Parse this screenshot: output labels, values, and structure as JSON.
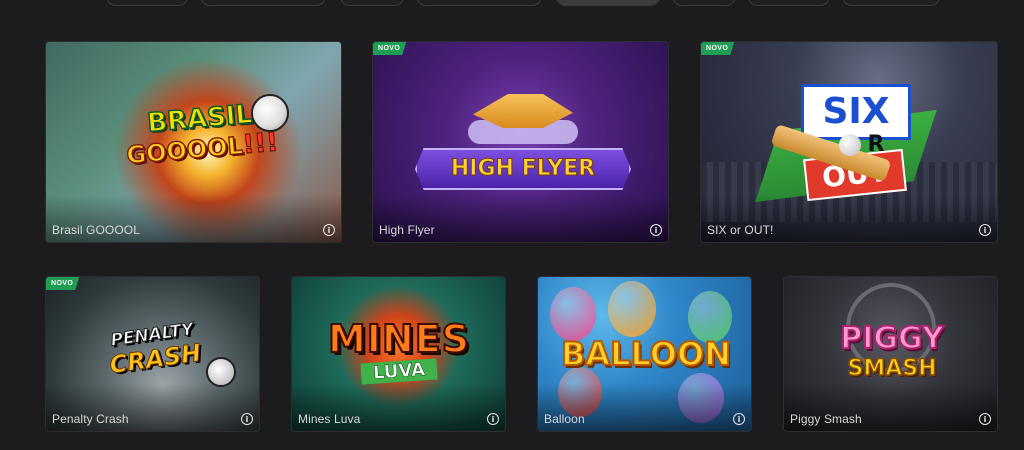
{
  "badge_label": "NOVO",
  "info_glyph": "i",
  "games": [
    {
      "title": "Brasil GOOOOL",
      "logo_line1": "BRASIL",
      "logo_line2": "GOOOOL",
      "logo_suffix": "!!!",
      "is_new": false
    },
    {
      "title": "High Flyer",
      "logo": "HIGH FLYER",
      "is_new": true
    },
    {
      "title": "SIX or OUT!",
      "logo_top": "SIX",
      "logo_mid": "R",
      "logo_bottom": "OUT",
      "is_new": true
    },
    {
      "title": "Penalty Crash",
      "logo_line1": "PENALTY",
      "logo_line2": "CRASH",
      "is_new": true
    },
    {
      "title": "Mines Luva",
      "logo_line1": "MINES",
      "logo_line2": "LUVA",
      "is_new": false
    },
    {
      "title": "Balloon",
      "logo": "BALLOON",
      "is_new": false
    },
    {
      "title": "Piggy Smash",
      "logo_line1": "PIGGY",
      "logo_line2": "SMASH",
      "is_new": false
    }
  ]
}
